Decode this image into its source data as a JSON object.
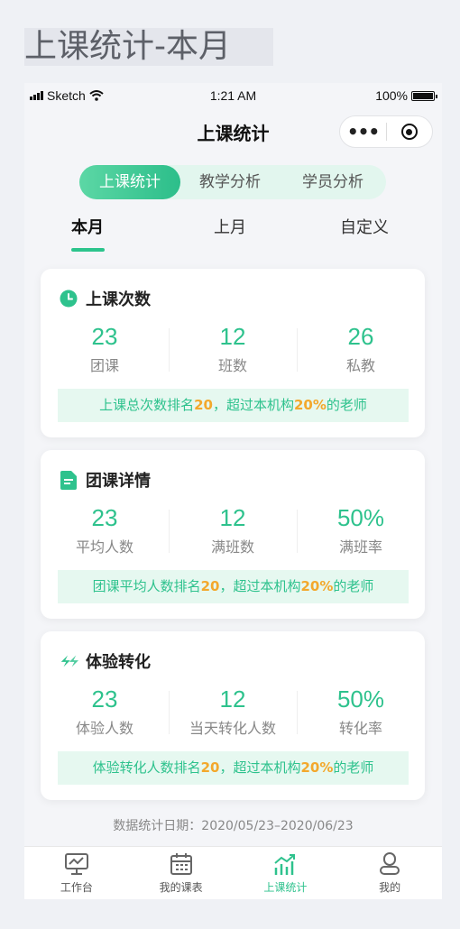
{
  "page_title": "上课统计-本月",
  "status_bar": {
    "carrier": "Sketch",
    "time": "1:21 AM",
    "battery": "100%"
  },
  "nav": {
    "title": "上课统计",
    "more": "•••"
  },
  "segments": [
    "上课统计",
    "教学分析",
    "学员分析"
  ],
  "period_tabs": [
    "本月",
    "上月",
    "自定义"
  ],
  "cards": [
    {
      "title": "上课次数",
      "stats": [
        {
          "value": "23",
          "label": "团课"
        },
        {
          "value": "12",
          "label": "班数"
        },
        {
          "value": "26",
          "label": "私教"
        }
      ],
      "rank": {
        "prefix": "上课总次数排名",
        "rank": "20",
        "mid": "，超过本机构",
        "pct": "20%",
        "suffix": "的老师"
      }
    },
    {
      "title": "团课详情",
      "stats": [
        {
          "value": "23",
          "label": "平均人数"
        },
        {
          "value": "12",
          "label": "满班数"
        },
        {
          "value": "50%",
          "label": "满班率"
        }
      ],
      "rank": {
        "prefix": "团课平均人数排名",
        "rank": "20",
        "mid": "，超过本机构",
        "pct": "20%",
        "suffix": "的老师"
      }
    },
    {
      "title": "体验转化",
      "stats": [
        {
          "value": "23",
          "label": "体验人数"
        },
        {
          "value": "12",
          "label": "当天转化人数"
        },
        {
          "value": "50%",
          "label": "转化率"
        }
      ],
      "rank": {
        "prefix": "体验转化人数排名",
        "rank": "20",
        "mid": "，超过本机构",
        "pct": "20%",
        "suffix": "的老师"
      }
    }
  ],
  "footer": "数据统计日期：2020/05/23–2020/06/23",
  "bottom_nav": [
    "工作台",
    "我的课表",
    "上课统计",
    "我的"
  ],
  "colors": {
    "accent": "#2ec28d",
    "highlight": "#f3a82c",
    "rank_bg": "#e6f8f0"
  }
}
